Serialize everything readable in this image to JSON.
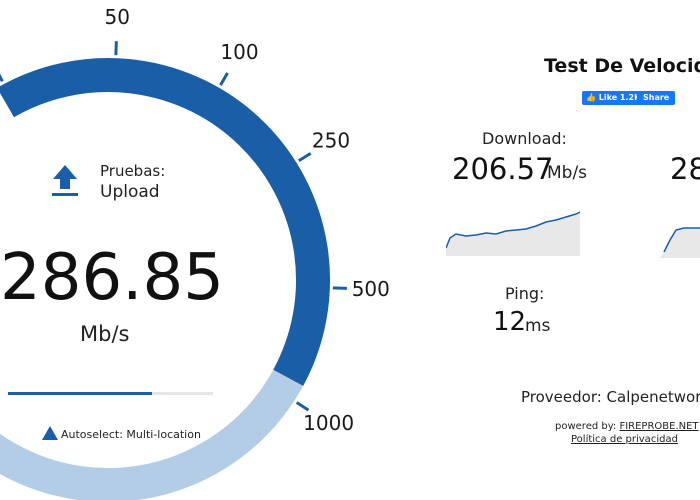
{
  "gauge": {
    "scale_labels": [
      "50",
      "100",
      "250",
      "500",
      "1000"
    ],
    "fill_fraction": 0.55,
    "colors": {
      "active": "#1a5ea8",
      "remaining": "#b3cde6"
    }
  },
  "test": {
    "type_label": "Pruebas:",
    "type_value": "Upload",
    "icon": "upload-icon",
    "speed": "286.85",
    "unit": "Mb/s",
    "progress": 0.7
  },
  "autoselect": {
    "text": "Autoselect: Multi-location"
  },
  "header": {
    "title": "Test De Velocidad"
  },
  "social": {
    "like_label": "Like 1.2K",
    "share_label": "Share"
  },
  "results": {
    "download": {
      "label": "Download:",
      "value": "206.57",
      "unit": "Mb/s"
    },
    "upload": {
      "value_partial": "28"
    },
    "ping": {
      "label": "Ping:",
      "value": "12",
      "unit": "ms"
    }
  },
  "provider": {
    "text": "Proveedor: Calpenetworks"
  },
  "footer": {
    "powered_prefix": "powered by: ",
    "powered_link": "FIREPROBE.NET",
    "privacy": "Política de privacidad"
  },
  "colors": {
    "accent": "#1a5ea8",
    "chart_fill": "#e8e8e8",
    "chart_line": "#1a5ea8"
  }
}
